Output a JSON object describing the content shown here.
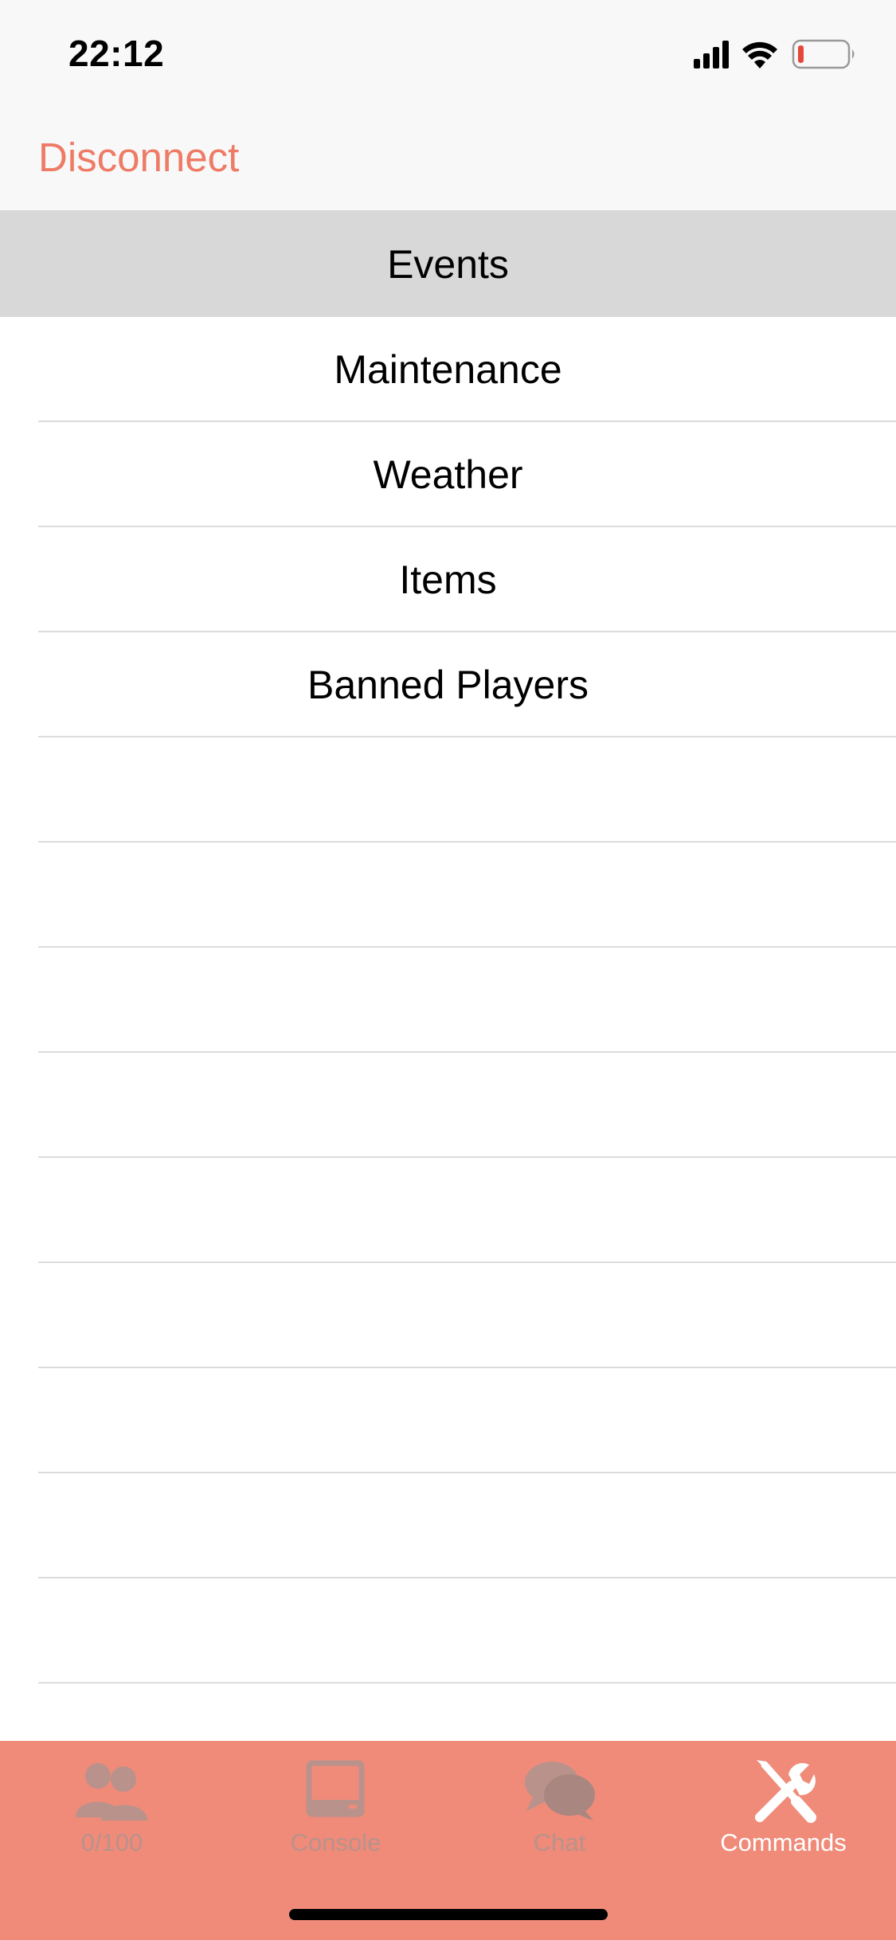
{
  "status_bar": {
    "time": "22:12",
    "icons": [
      "signal-icon",
      "wifi-icon",
      "battery-low-icon"
    ]
  },
  "nav": {
    "left_button": "Disconnect"
  },
  "section": {
    "title": "Events"
  },
  "rows": [
    {
      "label": "Maintenance"
    },
    {
      "label": "Weather"
    },
    {
      "label": "Items"
    },
    {
      "label": "Banned Players"
    },
    {
      "label": ""
    },
    {
      "label": ""
    },
    {
      "label": ""
    },
    {
      "label": ""
    },
    {
      "label": ""
    },
    {
      "label": ""
    },
    {
      "label": ""
    },
    {
      "label": ""
    },
    {
      "label": ""
    }
  ],
  "tabbar": {
    "tabs": [
      {
        "label": "0/100",
        "icon": "players-icon",
        "active": false
      },
      {
        "label": "Console",
        "icon": "console-icon",
        "active": false
      },
      {
        "label": "Chat",
        "icon": "chat-icon",
        "active": false
      },
      {
        "label": "Commands",
        "icon": "wrench-screwdriver-icon",
        "active": true
      }
    ]
  },
  "colors": {
    "accent": "#ee7b66",
    "tabbar_bg": "#f08b7a",
    "section_header_bg": "#d8d8d8",
    "battery_low": "#e5483b"
  }
}
